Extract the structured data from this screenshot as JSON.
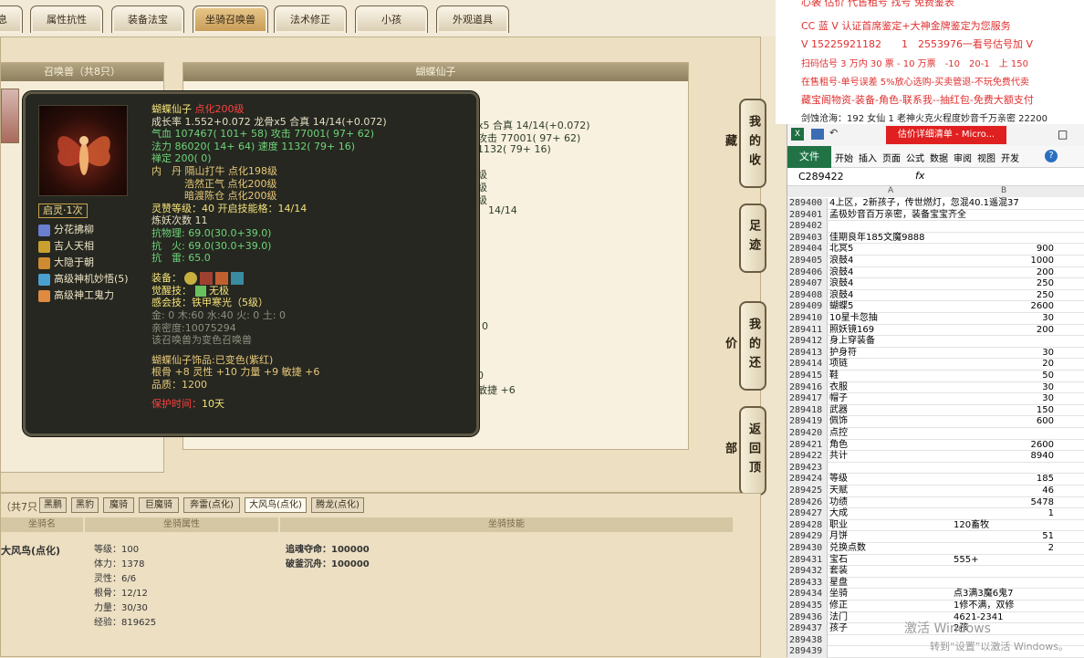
{
  "tabs": [
    "息",
    "属性抗性",
    "装备法宝",
    "坐骑召唤兽",
    "法术修正",
    "小孩",
    "外观道具"
  ],
  "active_tab": "坐骑召唤兽",
  "left_panel_title": "召唤兽（共8只）",
  "right_panel_title": "蝴蝶仙子",
  "side_buttons": [
    "我的收藏",
    "足迹",
    "我的还价",
    "返回顶部"
  ],
  "pet": {
    "name": "蝴蝶仙子",
    "level": "点化200级",
    "l1": "成长率 1.552+0.072 龙骨x5 合真 14/14(+0.072)",
    "l2": "气血 107467( 101+ 58) 攻击 77001( 97+ 62)",
    "l3": "法力 86020( 14+ 64) 速度 1132( 79+ 16)",
    "l4": "禅定 200( 0)",
    "l5": "内　丹 隔山打牛 点化198级",
    "l6": "浩然正气 点化200级",
    "l7": "暗渡陈仓 点化200级",
    "l8": "灵赞等级：40 开启技能格：14/14",
    "l9": "炼妖次数 11",
    "l10": "抗物理: 69.0(30.0+39.0)",
    "l11": "抗　火: 69.0(30.0+39.0)",
    "l12": "抗　雷: 65.0",
    "equip_label": "装备：",
    "awaken_label": "觉醒技：",
    "awaken_value": "无极",
    "l13": "感会技：铁甲寒光（5级）",
    "l14": "金: 0 木:60 水:40 火: 0 土: 0",
    "l15": "亲密度:10075294",
    "l16": "该召唤兽为变色召唤兽",
    "l17": "蝴蝶仙子饰品:已变色(紫红)",
    "l18": "根骨 +8 灵性 +10 力量 +9 敏捷 +6",
    "l19": "品质：1200",
    "protect_label": "保护时间：",
    "protect_value": "10天",
    "badge": "启灵·1次",
    "skills": [
      "分花拂柳",
      "吉人天相",
      "大隐于朝",
      "高级神机妙悟(5)",
      "高级神工鬼力"
    ]
  },
  "ghost_text": [
    "x5 合真 14/14(+0.072)",
    "攻击 77001( 97+ 62)",
    "1132( 79+ 16)",
    "级",
    "级",
    "级",
    "14/14",
    "0",
    "0",
    "敏捷 +6"
  ],
  "mount": {
    "count_label": "（共7只",
    "tabs": [
      "黑鹏",
      "黑豹",
      "魔骑",
      "巨魔骑",
      "奔雷(点化)",
      "大风鸟(点化)",
      "腾龙(点化)"
    ],
    "headers": [
      "坐骑名",
      "坐骑属性",
      "坐骑技能"
    ],
    "name": "大风鸟(点化)",
    "attrs": [
      "等级：100",
      "体力：1378",
      "灵性：6/6",
      "根骨：12/12",
      "力量：30/30",
      "经验：819625"
    ],
    "skills": [
      "追魂夺命：100000",
      "破釜沉舟：100000"
    ]
  },
  "ads": [
    {
      "t": "心袭 估价 代售租号 找号 免费鉴表",
      "c": "#e03030"
    },
    {
      "t": "CC 蓝 V 认证首席鉴定+大神金牌鉴定为您服务",
      "c": "#e03030"
    },
    {
      "t": "V 15225921182　　1　2553976一看号估号加 V",
      "c": "#e03030"
    },
    {
      "t": "扫码估号 3 万内 30 票 - 10 万票　-10　20-1　上 150",
      "c": "#e03030"
    },
    {
      "t": "在售租号-单号误差 5%放心选购-买卖管退-不玩免费代卖",
      "c": "#e03030"
    },
    {
      "t": "藏宝阁物资-装备-角色-联系我--抽红包-免费大额支付",
      "c": "#e03030"
    },
    {
      "t": "剑蚀沧海：192 女仙 1 老神火克火程度妙音千万亲密 22200",
      "c": "#222"
    }
  ],
  "excel": {
    "title": "估价详细清单 - Micro...",
    "ribbon": [
      "文件",
      "开始",
      "插入",
      "页面",
      "公式",
      "数据",
      "审阅",
      "视图",
      "开发"
    ],
    "namebox": "C289422",
    "fx": "fx",
    "col_a": "A",
    "col_b": "B",
    "rows": [
      [
        "289400",
        "4上区，2新孩子，传世燃灯，忽混40.1遥混37",
        ""
      ],
      [
        "289401",
        "孟极妙音百万亲密，装备宝宝齐全",
        ""
      ],
      [
        "289402",
        "",
        ""
      ],
      [
        "289403",
        "佳期良年185文魔9888",
        ""
      ],
      [
        "289404",
        "北冥5",
        "900"
      ],
      [
        "289405",
        "浪鼓4",
        "1000"
      ],
      [
        "289406",
        "浪鼓4",
        "200"
      ],
      [
        "289407",
        "浪鼓4",
        "250"
      ],
      [
        "289408",
        "浪鼓4",
        "250"
      ],
      [
        "289409",
        "蝴蝶5",
        "2600"
      ],
      [
        "289410",
        "10星卡忽抽",
        "30"
      ],
      [
        "289411",
        "照妖镜169",
        "200"
      ],
      [
        "289412",
        "身上穿装备",
        ""
      ],
      [
        "289413",
        "护身符",
        "30"
      ],
      [
        "289414",
        "项链",
        "20"
      ],
      [
        "289415",
        "鞋",
        "50"
      ],
      [
        "289416",
        "衣服",
        "30"
      ],
      [
        "289417",
        "帽子",
        "30"
      ],
      [
        "289418",
        "武器",
        "150"
      ],
      [
        "289419",
        "佩饰",
        "600"
      ],
      [
        "289420",
        "点控",
        ""
      ],
      [
        "289421",
        "角色",
        "2600"
      ],
      [
        "289422",
        "共计",
        "8940"
      ],
      [
        "289423",
        "",
        ""
      ],
      [
        "289424",
        "等级",
        "185"
      ],
      [
        "289425",
        "天赋",
        "46"
      ],
      [
        "289426",
        "功绩",
        "5478"
      ],
      [
        "289427",
        "大成",
        "1"
      ],
      [
        "289428",
        "职业",
        "120畜牧"
      ],
      [
        "289429",
        "月饼",
        "51"
      ],
      [
        "289430",
        "兑换点数",
        "2"
      ],
      [
        "289431",
        "宝石",
        "555+"
      ],
      [
        "289432",
        "套装",
        ""
      ],
      [
        "289433",
        "星盘",
        ""
      ],
      [
        "289434",
        "坐骑",
        "点3满3魔6鬼7"
      ],
      [
        "289435",
        "修正",
        "1修不满，双修"
      ],
      [
        "289436",
        "法门",
        "4621-2341"
      ],
      [
        "289437",
        "孩子",
        "2孩"
      ],
      [
        "289438",
        "",
        ""
      ],
      [
        "289439",
        "",
        ""
      ]
    ],
    "watermark1": "激活 Windows",
    "watermark2": "转到“设置”以激活 Windows。"
  }
}
